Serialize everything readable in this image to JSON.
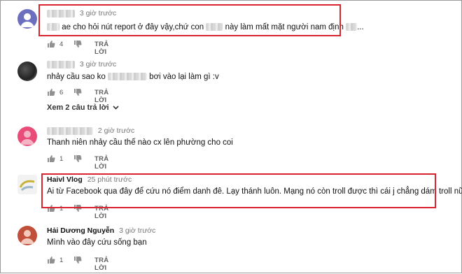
{
  "comments": [
    {
      "time": "3 giờ trước",
      "text_pre": "ae cho hỏi nút report ở đây vậy,chứ con",
      "text_mid": "này làm mất mặt người nam định",
      "likes": "4",
      "reply": "TRẢ LỜI",
      "avatar_color": "#6c6fbd"
    },
    {
      "time": "3 giờ trước",
      "text_pre": "nhảy cầu sao ko",
      "text_mid": "bơi vào lại làm gì :v",
      "likes": "6",
      "reply": "TRẢ LỜI",
      "more_replies": "Xem 2 câu trả lời"
    },
    {
      "time": "2 giờ trước",
      "text": "Thanh niên nhảy cầu thế nào cx lên phường cho coi",
      "likes": "1",
      "reply": "TRẢ LỜI",
      "avatar_color": "#e84d7a"
    },
    {
      "author": "Haivl Vlog",
      "time": "25 phút trước",
      "text": "Ai từ Facebook qua đây để cứu nó điểm danh đê. Lạy thánh luôn. Mạng nó còn troll được thì cái j chẳng dám troll nữa",
      "likes": "1",
      "reply": "TRẢ LỜI"
    },
    {
      "author": "Hải Dương Nguyễn",
      "time": "3 giờ trước",
      "text": "Mình vào đây cứu sống bạn",
      "likes": "1",
      "reply": "TRẢ LỜI",
      "avatar_color": "#c0503a"
    }
  ],
  "highlight_color": "#d9232e"
}
